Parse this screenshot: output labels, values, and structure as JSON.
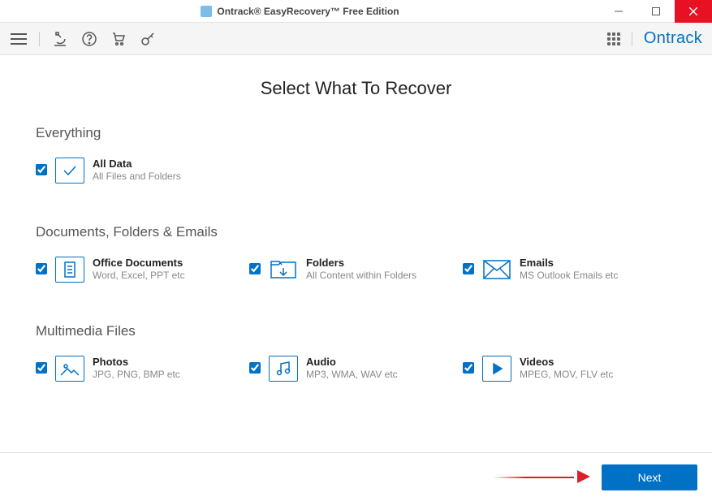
{
  "window": {
    "title": "Ontrack® EasyRecovery™ Free Edition"
  },
  "brand": "Ontrack",
  "page_title": "Select What To Recover",
  "sections": {
    "everything": {
      "heading": "Everything",
      "alldata": {
        "title": "All Data",
        "sub": "All Files and Folders"
      }
    },
    "docs": {
      "heading": "Documents, Folders & Emails",
      "office": {
        "title": "Office Documents",
        "sub": "Word, Excel, PPT etc"
      },
      "folders": {
        "title": "Folders",
        "sub": "All Content within Folders"
      },
      "emails": {
        "title": "Emails",
        "sub": "MS Outlook Emails etc"
      }
    },
    "media": {
      "heading": "Multimedia Files",
      "photos": {
        "title": "Photos",
        "sub": "JPG, PNG, BMP etc"
      },
      "audio": {
        "title": "Audio",
        "sub": "MP3, WMA, WAV etc"
      },
      "videos": {
        "title": "Videos",
        "sub": "MPEG, MOV, FLV etc"
      }
    }
  },
  "footer": {
    "next": "Next"
  }
}
